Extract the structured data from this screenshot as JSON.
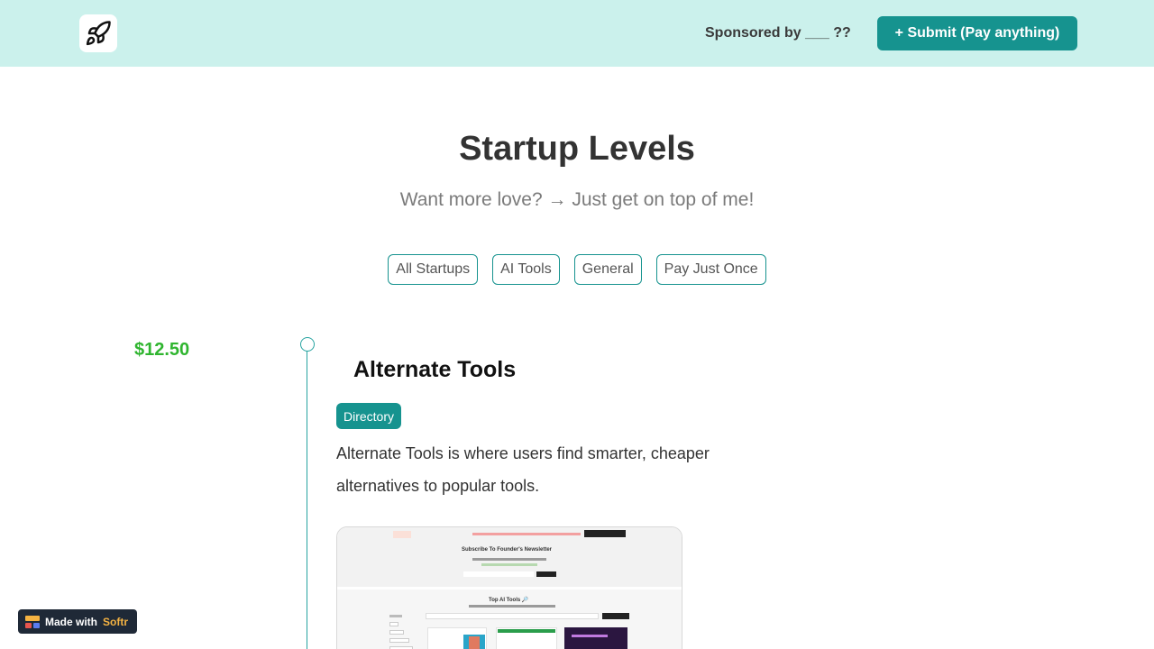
{
  "header": {
    "logo_icon": "rocket-icon",
    "sponsor_text": "Sponsored by ___ ??",
    "submit_label": "+ Submit (Pay anything)"
  },
  "hero": {
    "title": "Startup Levels",
    "subtitle": "Want more love? → Just get on top of me!"
  },
  "filters": [
    {
      "label": "All Startups"
    },
    {
      "label": "AI Tools"
    },
    {
      "label": "General"
    },
    {
      "label": "Pay Just Once"
    }
  ],
  "listing": {
    "price": "$12.50",
    "title": "Alternate Tools",
    "tag": "Directory",
    "description": "Alternate Tools is where users find smarter, cheaper alternatives to popular tools.",
    "preview": {
      "headline": "Subscribe To Founder's Newsletter",
      "section_title": "Top AI Tools 🔎"
    }
  },
  "badge": {
    "prefix": "Made with",
    "brand": "Softr"
  },
  "colors": {
    "header_bg": "#cbf1ec",
    "accent": "#16938f",
    "price": "#2fb52f",
    "badge_bg": "#1f2937"
  }
}
